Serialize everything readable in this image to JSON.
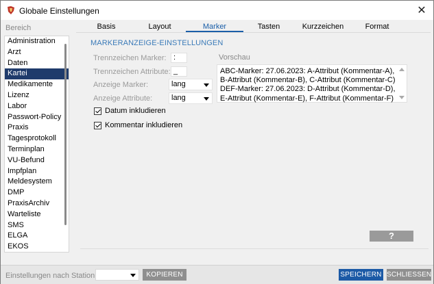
{
  "window": {
    "title": "Globale Einstellungen"
  },
  "sidebar": {
    "label": "Bereich",
    "items": [
      {
        "label": "Administration",
        "selected": false
      },
      {
        "label": "Arzt",
        "selected": false
      },
      {
        "label": "Daten",
        "selected": false
      },
      {
        "label": "Kartei",
        "selected": true
      },
      {
        "label": "Medikamente",
        "selected": false
      },
      {
        "label": "Lizenz",
        "selected": false
      },
      {
        "label": "Labor",
        "selected": false
      },
      {
        "label": "Passwort-Policy",
        "selected": false
      },
      {
        "label": "Praxis",
        "selected": false
      },
      {
        "label": "Tagesprotokoll",
        "selected": false
      },
      {
        "label": "Terminplan",
        "selected": false
      },
      {
        "label": "VU-Befund",
        "selected": false
      },
      {
        "label": "Impfplan",
        "selected": false
      },
      {
        "label": "Meldesystem",
        "selected": false
      },
      {
        "label": "DMP",
        "selected": false
      },
      {
        "label": "PraxisArchiv",
        "selected": false
      },
      {
        "label": "Warteliste",
        "selected": false
      },
      {
        "label": "SMS",
        "selected": false
      },
      {
        "label": "ELGA",
        "selected": false
      },
      {
        "label": "EKOS",
        "selected": false
      }
    ]
  },
  "tabs": [
    {
      "label": "Basis",
      "active": false
    },
    {
      "label": "Layout",
      "active": false
    },
    {
      "label": "Marker",
      "active": true
    },
    {
      "label": "Tasten",
      "active": false
    },
    {
      "label": "Kurzzeichen",
      "active": false
    },
    {
      "label": "Format",
      "active": false
    }
  ],
  "marker": {
    "section_title": "MARKERANZEIGE-EINSTELLUNGEN",
    "separator_marker_label": "Trennzeichen Marker:",
    "separator_marker_value": ":",
    "separator_attribute_label": "Trennzeichen Attribute:",
    "separator_attribute_value": "_",
    "display_marker_label": "Anzeige Marker:",
    "display_marker_value": "lang",
    "display_attribute_label": "Anzeige Attribute:",
    "display_attribute_value": "lang",
    "include_date_label": "Datum inkludieren",
    "include_date_checked": true,
    "include_comment_label": "Kommentar inkludieren",
    "include_comment_checked": true,
    "preview_label": "Vorschau",
    "preview_text": "ABC-Marker: 27.06.2023: A-Attribut (Kommentar-A), B-Attribut (Kommentar-B), C-Attribut (Kommentar-C) DEF-Marker: 27.06.2023: D-Attribut (Kommentar-D), E-Attribut (Kommentar-E), F-Attribut (Kommentar-F)"
  },
  "help_button": {
    "label": "?"
  },
  "bottom": {
    "station_label": "Einstellungen nach Station",
    "station_value": "",
    "copy_label": "KOPIEREN",
    "save_label": "SPEICHERN",
    "close_label": "SCHLIESSEN"
  },
  "colors": {
    "accent": "#1a5ea8",
    "selected_item_bg": "#1f3b6b",
    "save_button": "#1c5aa6",
    "grey_button": "#8f8f8f"
  }
}
